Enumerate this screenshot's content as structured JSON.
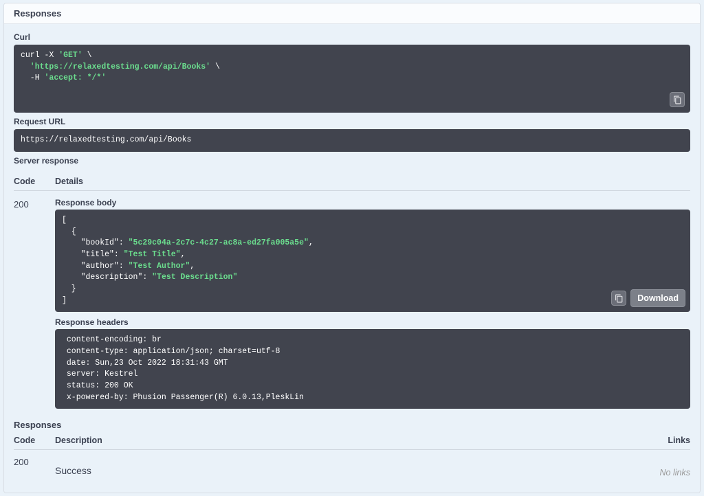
{
  "section": {
    "title": "Responses"
  },
  "curl": {
    "label": "Curl",
    "line1_prefix": "curl -X ",
    "line1_method": "'GET'",
    "line1_suffix": " \\",
    "line2": "  'https://relaxedtesting.com/api/Books'",
    "line2_suffix": " \\",
    "line3_prefix": "  -H ",
    "line3_val": "'accept: */*'"
  },
  "request_url": {
    "label": "Request URL",
    "value": "https://relaxedtesting.com/api/Books"
  },
  "server_response": {
    "label": "Server response",
    "code_header": "Code",
    "details_header": "Details",
    "code": "200",
    "response_body_label": "Response body",
    "response_body_open": "[",
    "response_body_obj_open": "  {",
    "body_k1": "    \"bookId\"",
    "body_v1": "\"5c29c04a-2c7c-4c27-ac8a-ed27fa005a5e\"",
    "body_k2": "    \"title\"",
    "body_v2": "\"Test Title\"",
    "body_k3": "    \"author\"",
    "body_v3": "\"Test Author\"",
    "body_k4": "    \"description\"",
    "body_v4": "\"Test Description\"",
    "response_body_obj_close": "  }",
    "response_body_close": "]",
    "download_label": "Download",
    "response_headers_label": "Response headers",
    "headers_text": " content-encoding: br\n content-type: application/json; charset=utf-8\n date: Sun,23 Oct 2022 18:31:43 GMT\n server: Kestrel\n status: 200 OK\n x-powered-by: Phusion Passenger(R) 6.0.13,PleskLin"
  },
  "responses_list": {
    "label": "Responses",
    "code_header": "Code",
    "desc_header": "Description",
    "links_header": "Links",
    "code": "200",
    "desc": "Success",
    "links": "No links"
  }
}
